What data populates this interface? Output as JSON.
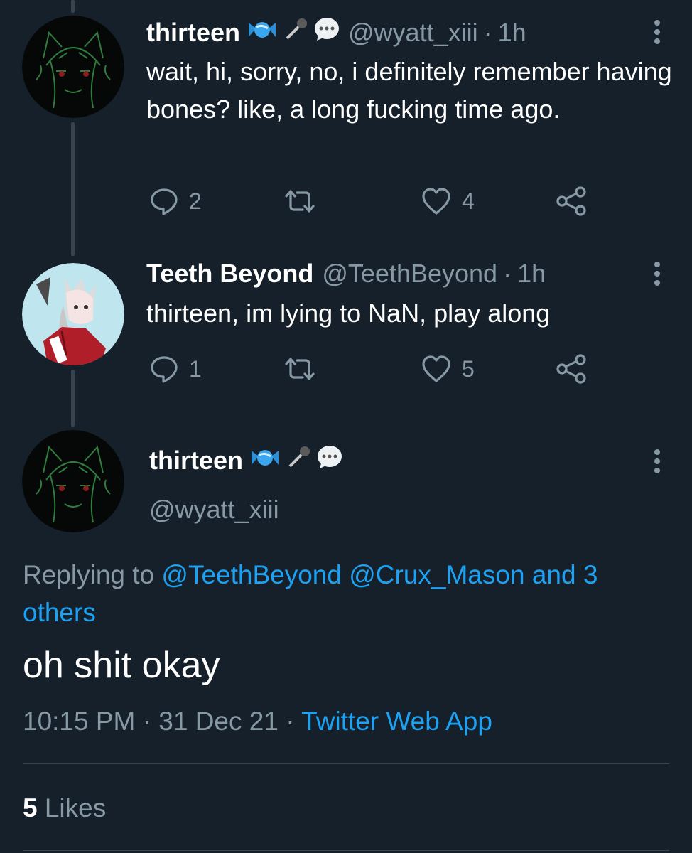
{
  "tweets": [
    {
      "name": "thirteen",
      "handle": "@wyatt_xiii",
      "time": "1h",
      "text": "wait, hi, sorry, no, i definitely remember having bones? like, a long fucking time ago.",
      "reply_count": "2",
      "retweet_count": "",
      "like_count": "4"
    },
    {
      "name": "Teeth Beyond",
      "handle": "@TeethBeyond",
      "time": "1h",
      "text": "thirteen, im lying to NaN, play along",
      "reply_count": "1",
      "retweet_count": "",
      "like_count": "5"
    }
  ],
  "focused": {
    "name": "thirteen",
    "handle": "@wyatt_xiii",
    "replying_prefix": "Replying to",
    "replying_to": "@TeethBeyond @Crux_Mason and 3 others",
    "text": "oh shit okay",
    "time": "10:15 PM",
    "date": "31 Dec 21",
    "source": "Twitter Web App",
    "likes_count": "5",
    "likes_label": "Likes"
  },
  "separator": "·",
  "colors": {
    "background": "#15202b",
    "secondary": "#8899a6",
    "accent": "#1da1f2",
    "line": "#38444d"
  },
  "icons": [
    "reply-icon",
    "retweet-icon",
    "like-icon",
    "share-icon",
    "candy-emoji",
    "microphone-emoji",
    "speech-bubble-emoji",
    "more-icon"
  ]
}
